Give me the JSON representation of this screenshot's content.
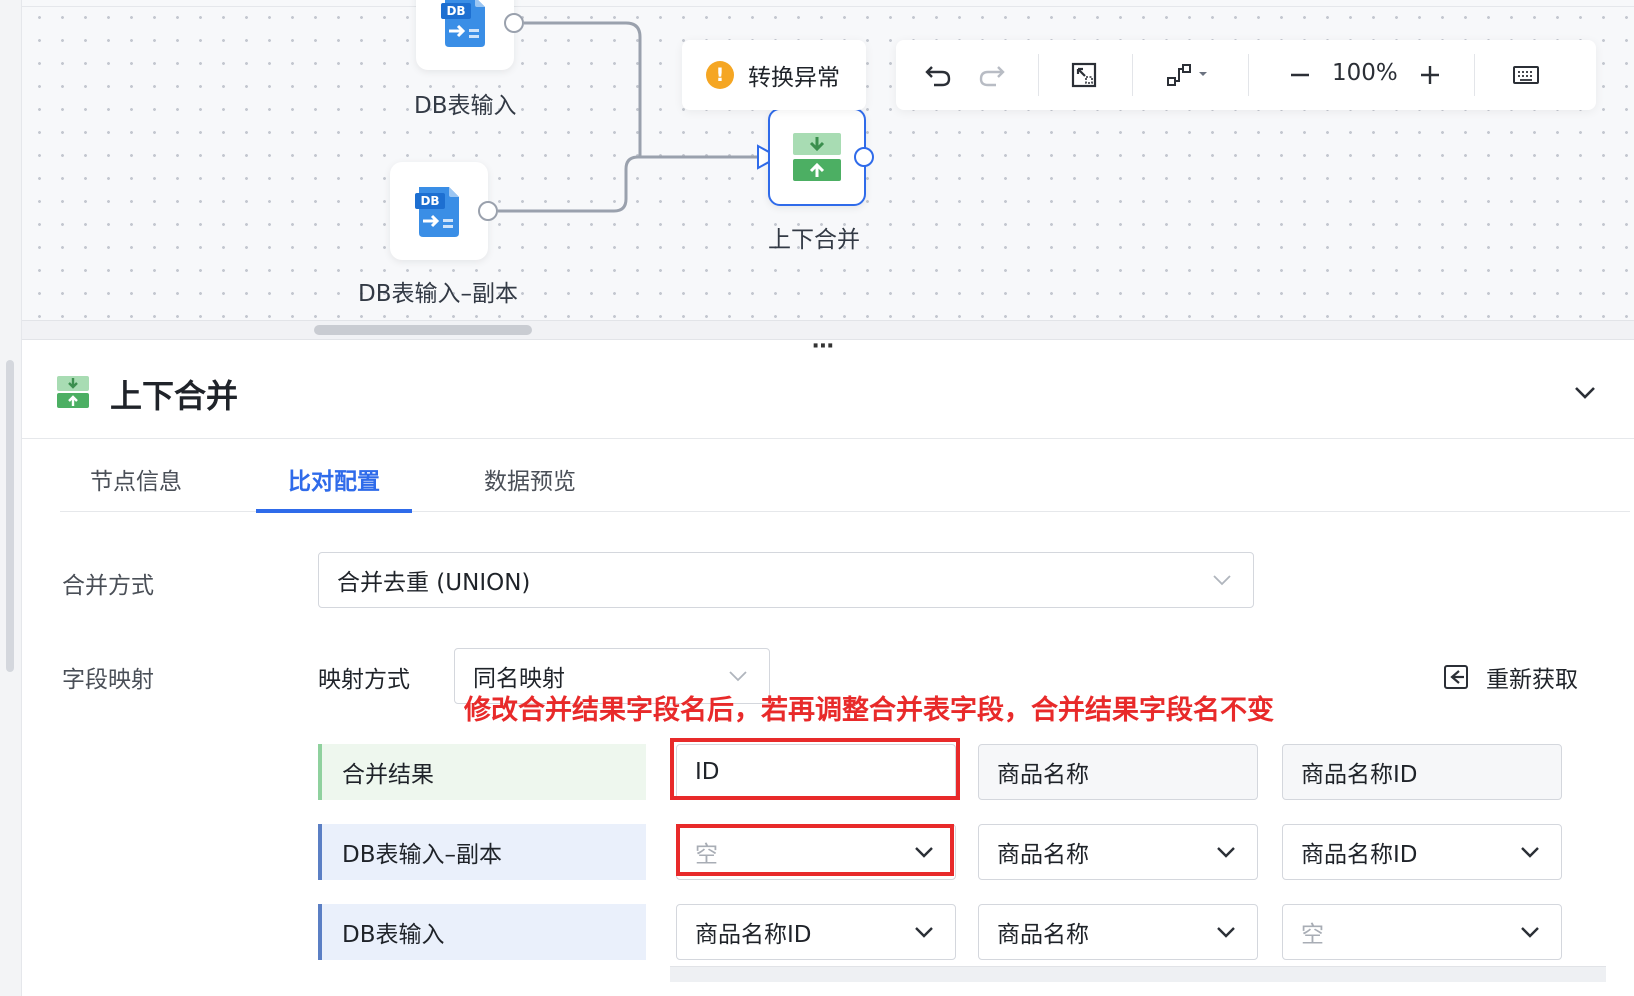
{
  "canvas": {
    "nodes": {
      "db_input": {
        "label": "DB表输入",
        "icon": "db-input-icon",
        "badge": "DB"
      },
      "db_input_copy": {
        "label": "DB表输入–副本",
        "icon": "db-input-icon",
        "badge": "DB"
      },
      "merge": {
        "label": "上下合并",
        "icon": "merge-vertical-icon"
      }
    },
    "warning": {
      "icon": "warning-icon",
      "text": "转换异常"
    },
    "toolbar": {
      "undo_icon": "undo-icon",
      "redo_icon": "redo-icon",
      "fit_icon": "fit-view-icon",
      "layout_icon": "layout-icon",
      "zoom_out_icon": "minus-icon",
      "zoom_level": "100%",
      "zoom_in_icon": "plus-icon",
      "keyboard_icon": "keyboard-icon"
    }
  },
  "splitter": {
    "handle": "⋯"
  },
  "panel": {
    "title": "上下合并",
    "icon": "merge-vertical-icon",
    "collapse_icon": "chevron-down-icon",
    "tabs": [
      {
        "label": "节点信息",
        "active": false
      },
      {
        "label": "比对配置",
        "active": true
      },
      {
        "label": "数据预览",
        "active": false
      }
    ],
    "merge_mode": {
      "label": "合并方式",
      "value": "合并去重 (UNION)"
    },
    "field_mapping": {
      "label": "字段映射",
      "mapping_mode_label": "映射方式",
      "mapping_mode_value": "同名映射",
      "refresh_label": "重新获取",
      "refresh_icon": "refresh-icon"
    },
    "annotation": "修改合并结果字段名后，若再调整合并表字段，合并结果字段名不变",
    "rows": [
      {
        "label": "合并结果",
        "cells": [
          "ID",
          "商品名称",
          "商品名称ID"
        ]
      },
      {
        "label": "DB表输入–副本",
        "cells": [
          "空",
          "商品名称",
          "商品名称ID"
        ]
      },
      {
        "label": "DB表输入",
        "cells": [
          "商品名称ID",
          "商品名称",
          "空"
        ]
      }
    ]
  },
  "colors": {
    "accent": "#2f6bea",
    "warning": "#f5a623",
    "annotation_red": "#e82a2a",
    "merge_green": "#4caf63"
  }
}
